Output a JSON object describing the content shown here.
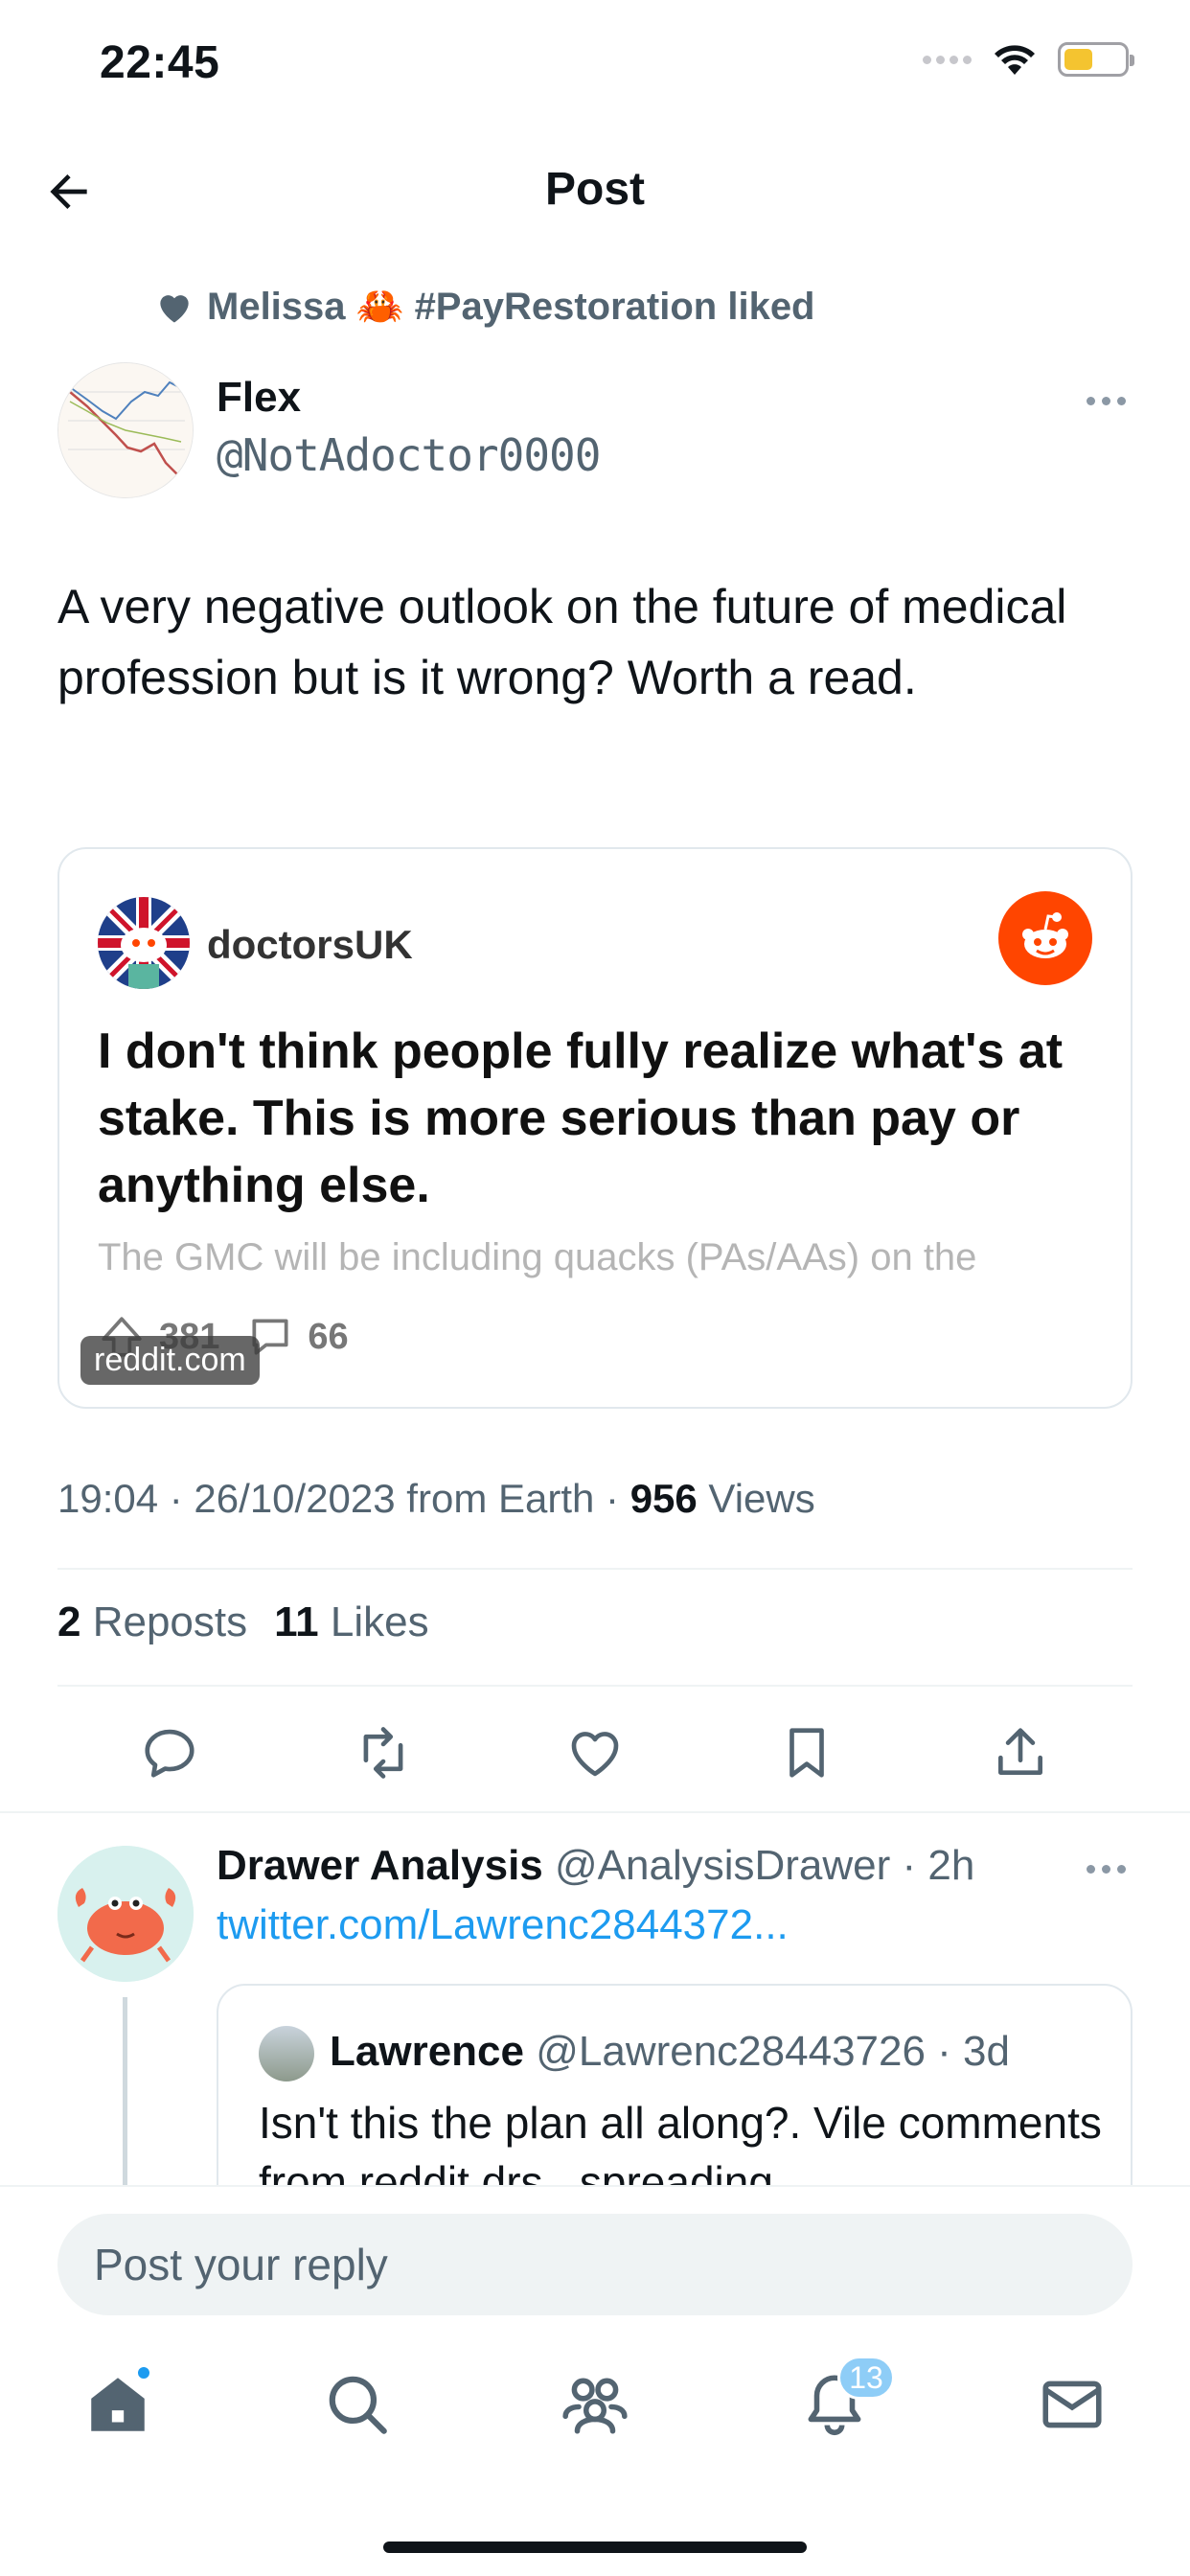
{
  "status_bar": {
    "time": "22:45"
  },
  "header": {
    "title": "Post"
  },
  "liked_by": "Melissa 🦀 #PayRestoration liked",
  "post": {
    "author_name": "Flex",
    "author_handle": "@NotAdoctor0000",
    "text": "A very negative outlook on the future of medical profession but is it wrong? Worth a read.",
    "card": {
      "subreddit": "doctorsUK",
      "title": "I don't think people fully realize what's at stake. This is more serious than pay or anything else.",
      "snippet": "The GMC will be including quacks (PAs/AAs) on the",
      "upvotes": "381",
      "comments": "66",
      "domain": "reddit.com",
      "brand_color": "#ff4500"
    },
    "timestamp": "19:04 · 26/10/2023 from Earth · ",
    "views_count": "956",
    "views_label": " Views",
    "reposts_count": "2",
    "reposts_label": " Reposts",
    "likes_count": "11",
    "likes_label": " Likes"
  },
  "actions": [
    "reply-icon",
    "repost-icon",
    "like-icon",
    "bookmark-icon",
    "share-icon"
  ],
  "reply": {
    "author_name": "Drawer Analysis",
    "author_handle": " @AnalysisDrawer",
    "time": " · 2h",
    "link": "twitter.com/Lawrenc2844372...",
    "quote": {
      "author_name": "Lawrence",
      "author_handle": " @Lawrenc28443726",
      "time": " · 3d",
      "text": "Isn't this the plan all along?. Vile comments from reddit drs , spreading"
    }
  },
  "composer": {
    "placeholder": "Post your reply"
  },
  "tabs": {
    "items": [
      "home-icon",
      "search-icon",
      "communities-icon",
      "notifications-icon",
      "messages-icon"
    ],
    "notifications_count": "13"
  },
  "colors": {
    "accent": "#1d9bf0",
    "secondary_text": "#536471",
    "divider": "#eff3f4"
  }
}
